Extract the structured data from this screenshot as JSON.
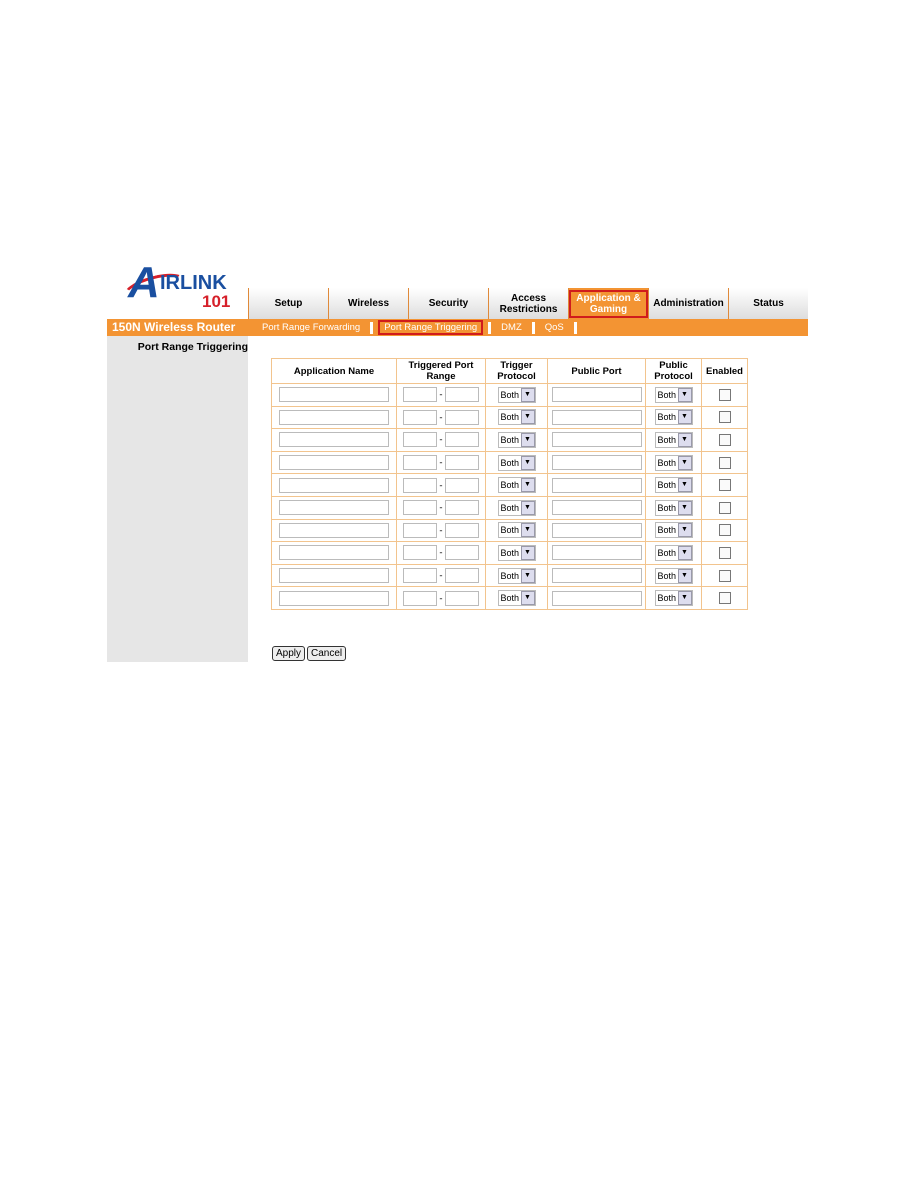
{
  "logo": {
    "text": "AIRLINK 101"
  },
  "tabs": [
    {
      "label": "Setup"
    },
    {
      "label": "Wireless"
    },
    {
      "label": "Security"
    },
    {
      "label": "Access Restrictions"
    },
    {
      "label": "Application & Gaming",
      "active": true
    },
    {
      "label": "Administration"
    },
    {
      "label": "Status"
    }
  ],
  "brand": "150N Wireless Router",
  "subnav": [
    {
      "label": "Port Range Forwarding"
    },
    {
      "label": "Port Range Triggering",
      "active": true
    },
    {
      "label": "DMZ"
    },
    {
      "label": "QoS"
    }
  ],
  "sidebar": {
    "title": "Port Range Triggering"
  },
  "table": {
    "headers": [
      "Application Name",
      "Triggered Port Range",
      "Trigger Protocol",
      "Public Port",
      "Public Protocol",
      "Enabled"
    ],
    "rows": [
      {
        "app": "",
        "start": "",
        "end": "",
        "trigger_protocol": "Both",
        "public_port": "",
        "public_protocol": "Both",
        "enabled": false
      },
      {
        "app": "",
        "start": "",
        "end": "",
        "trigger_protocol": "Both",
        "public_port": "",
        "public_protocol": "Both",
        "enabled": false
      },
      {
        "app": "",
        "start": "",
        "end": "",
        "trigger_protocol": "Both",
        "public_port": "",
        "public_protocol": "Both",
        "enabled": false
      },
      {
        "app": "",
        "start": "",
        "end": "",
        "trigger_protocol": "Both",
        "public_port": "",
        "public_protocol": "Both",
        "enabled": false
      },
      {
        "app": "",
        "start": "",
        "end": "",
        "trigger_protocol": "Both",
        "public_port": "",
        "public_protocol": "Both",
        "enabled": false
      },
      {
        "app": "",
        "start": "",
        "end": "",
        "trigger_protocol": "Both",
        "public_port": "",
        "public_protocol": "Both",
        "enabled": false
      },
      {
        "app": "",
        "start": "",
        "end": "",
        "trigger_protocol": "Both",
        "public_port": "",
        "public_protocol": "Both",
        "enabled": false
      },
      {
        "app": "",
        "start": "",
        "end": "",
        "trigger_protocol": "Both",
        "public_port": "",
        "public_protocol": "Both",
        "enabled": false
      },
      {
        "app": "",
        "start": "",
        "end": "",
        "trigger_protocol": "Both",
        "public_port": "",
        "public_protocol": "Both",
        "enabled": false
      },
      {
        "app": "",
        "start": "",
        "end": "",
        "trigger_protocol": "Both",
        "public_port": "",
        "public_protocol": "Both",
        "enabled": false
      }
    ],
    "range_separator": "-"
  },
  "buttons": {
    "apply": "Apply",
    "cancel": "Cancel"
  },
  "colors": {
    "accent": "#f39433",
    "highlight": "#d01c1c",
    "brand_blue": "#1a4fa0"
  }
}
